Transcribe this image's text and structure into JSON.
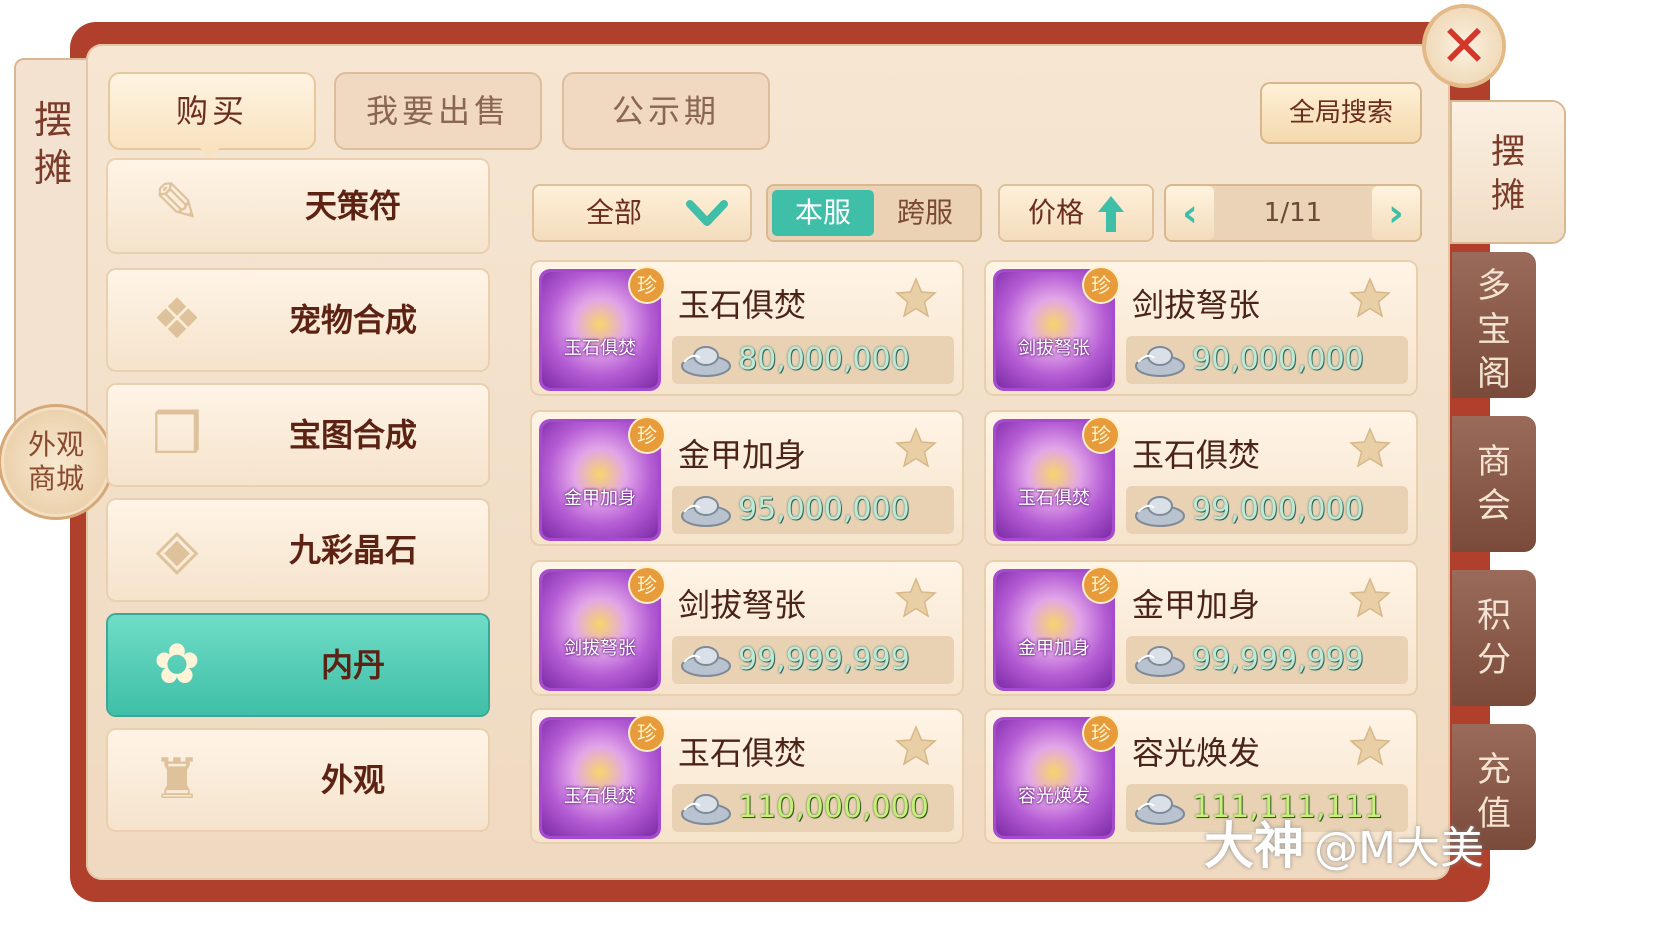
{
  "left_label": "摆摊",
  "outfit_mall": "外观商城",
  "close": "✕",
  "tabs": [
    {
      "label": "购买",
      "active": true
    },
    {
      "label": "我要出售",
      "active": false
    },
    {
      "label": "公示期",
      "active": false
    }
  ],
  "global_search": "全局搜索",
  "categories": [
    {
      "label": "天策符",
      "icon": "talisman-icon"
    },
    {
      "label": "宠物合成",
      "icon": "scroll-icon"
    },
    {
      "label": "宝图合成",
      "icon": "map-icon"
    },
    {
      "label": "九彩晶石",
      "icon": "crystal-icon"
    },
    {
      "label": "内丹",
      "icon": "pet-core-icon",
      "active": true
    },
    {
      "label": "外观",
      "icon": "robe-icon"
    }
  ],
  "filters": {
    "dropdown": "全部",
    "server_local": "本服",
    "server_cross": "跨服",
    "price": "价格",
    "page": "1/11"
  },
  "items": [
    {
      "name": "玉石俱焚",
      "icon_label": "玉石俱焚",
      "badge": "珍",
      "price": "80,000,000"
    },
    {
      "name": "剑拔弩张",
      "icon_label": "剑拔弩张",
      "badge": "珍",
      "price": "90,000,000"
    },
    {
      "name": "金甲加身",
      "icon_label": "金甲加身",
      "badge": "珍",
      "price": "95,000,000"
    },
    {
      "name": "玉石俱焚",
      "icon_label": "玉石俱焚",
      "badge": "珍",
      "price": "99,000,000"
    },
    {
      "name": "剑拔弩张",
      "icon_label": "剑拔弩张",
      "badge": "珍",
      "price": "99,999,999"
    },
    {
      "name": "金甲加身",
      "icon_label": "金甲加身",
      "badge": "珍",
      "price": "99,999,999"
    },
    {
      "name": "玉石俱焚",
      "icon_label": "玉石俱焚",
      "badge": "珍",
      "price": "110,000,000"
    },
    {
      "name": "容光焕发",
      "icon_label": "容光焕发",
      "badge": "珍",
      "price": "111,111,111"
    }
  ],
  "side_tabs": [
    {
      "label": "摆摊",
      "active": true
    },
    {
      "label": "多宝阁"
    },
    {
      "label": "商会"
    },
    {
      "label": "积分"
    },
    {
      "label": "充值"
    }
  ],
  "watermark": {
    "brand": "大神",
    "handle": "@M大美"
  },
  "colors": {
    "accent": "#3fbfa7",
    "frame": "#b0402c",
    "rare_border": "#a64ad0"
  }
}
